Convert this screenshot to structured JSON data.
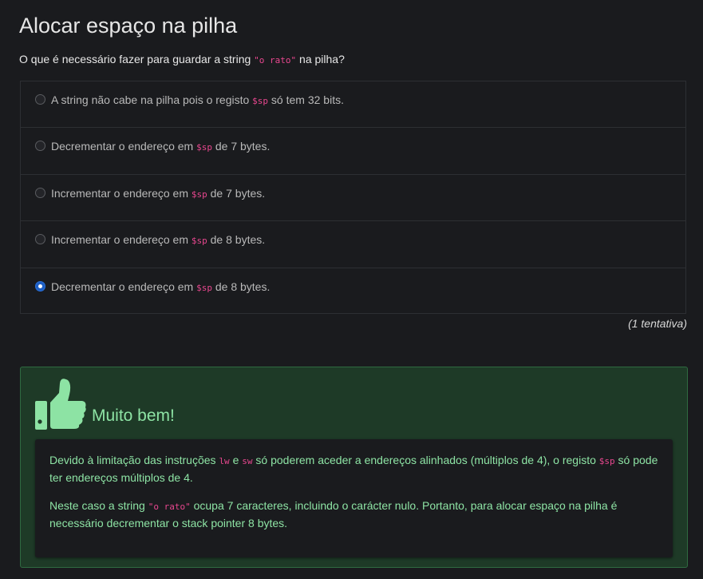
{
  "page": {
    "title": "Alocar espaço na pilha"
  },
  "question": {
    "before": "O que é necessário fazer para guardar a string ",
    "code": "\"o rato\"",
    "after": " na pilha?"
  },
  "options": [
    {
      "before": "A string não cabe na pilha pois o registo ",
      "code": "$sp",
      "after": " só tem 32 bits.",
      "selected": false
    },
    {
      "before": "Decrementar o endereço em ",
      "code": "$sp",
      "after": " de 7 bytes.",
      "selected": false
    },
    {
      "before": "Incrementar o endereço em ",
      "code": "$sp",
      "after": " de 7 bytes.",
      "selected": false
    },
    {
      "before": "Incrementar o endereço em ",
      "code": "$sp",
      "after": " de 8 bytes.",
      "selected": false
    },
    {
      "before": "Decrementar o endereço em ",
      "code": "$sp",
      "after": " de 8 bytes.",
      "selected": true
    }
  ],
  "attempts": "(1 tentativa)",
  "feedback": {
    "icon": "thumbs-up-icon",
    "title": "Muito bem!",
    "p1": {
      "t1": "Devido à limitação das instruções ",
      "c1": "lw",
      "t2": " e ",
      "c2": "sw",
      "t3": " só poderem aceder a endereços alinhados (múltiplos de 4), o registo ",
      "c3": "$sp",
      "t4": " só pode ter endereços múltiplos de 4."
    },
    "p2": {
      "t1": "Neste caso a string ",
      "c1": "\"o rato\"",
      "t2": " ocupa 7 caracteres, incluindo o carácter nulo. Portanto, para alocar espaço na pilha é necessário decrementar o stack pointer 8 bytes."
    }
  },
  "colors": {
    "background": "#1a1b1e",
    "code": "#e8478f",
    "success_text": "#8de3a4",
    "success_bg": "#1e3a27",
    "radio_selected": "#1d5ec4"
  }
}
